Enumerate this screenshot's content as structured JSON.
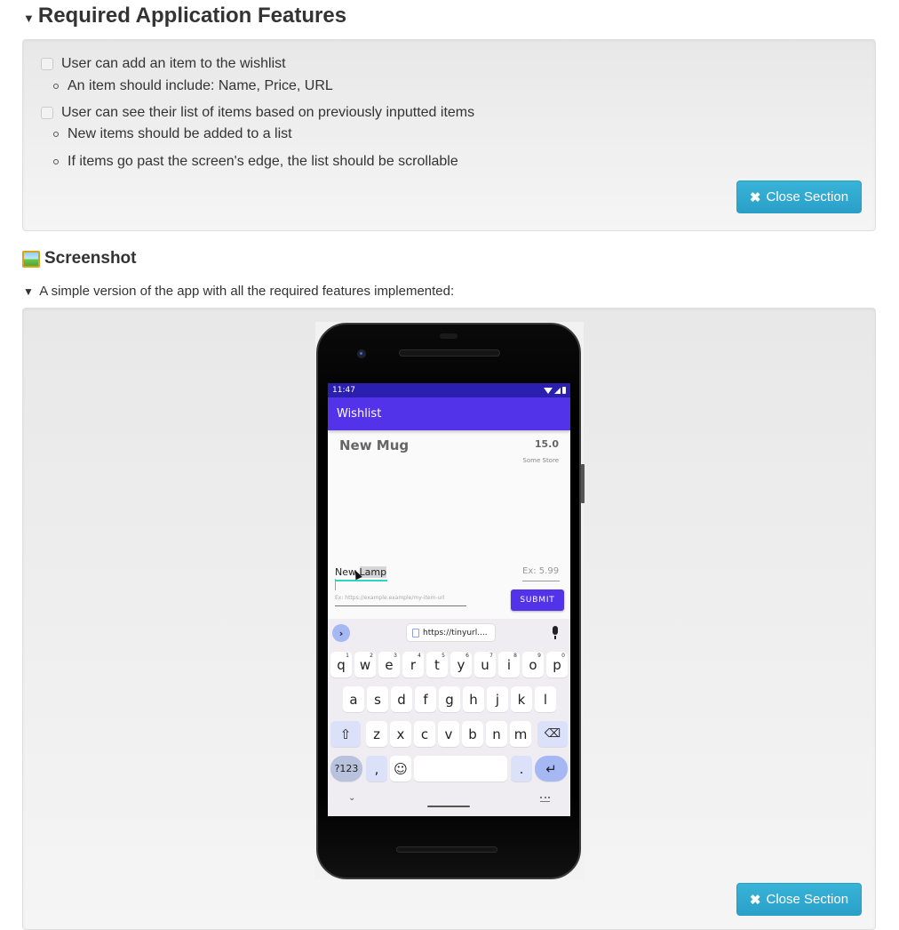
{
  "section1": {
    "title": "Required Application Features",
    "tasks": [
      {
        "label": "User can add an item to the wishlist",
        "checked": false,
        "subitems": [
          "An item should include: Name, Price, URL"
        ]
      },
      {
        "label": "User can see their list of items based on previously inputted items",
        "checked": false,
        "subitems": [
          "New items should be added to a list",
          "If items go past the screen's edge, the list should be scrollable"
        ]
      }
    ],
    "close_label": "Close Section",
    "close_icon": "✖"
  },
  "section2": {
    "title": "Screenshot",
    "icon": "framed-picture-icon",
    "summary": "A simple version of the app with all the required features implemented:",
    "close_label": "Close Section",
    "close_icon": "✖"
  },
  "phone": {
    "status_time": "11:47",
    "app_title": "Wishlist",
    "items": [
      {
        "name": "New Mug",
        "price": "15.0",
        "store": "Some Store"
      }
    ],
    "name_input_value": "New Lamp",
    "name_input_value_prefix": "New",
    "name_input_value_selected": "Lamp",
    "price_placeholder": "Ex: 5.99",
    "url_placeholder": "Ex: https://example.example/my-item-url",
    "submit_label": "SUBMIT",
    "keyboard": {
      "clipboard_suggestion": "https://tinyurl....",
      "row1": [
        {
          "k": "q",
          "n": "1"
        },
        {
          "k": "w",
          "n": "2"
        },
        {
          "k": "e",
          "n": "3"
        },
        {
          "k": "r",
          "n": "4"
        },
        {
          "k": "t",
          "n": "5"
        },
        {
          "k": "y",
          "n": "6"
        },
        {
          "k": "u",
          "n": "7"
        },
        {
          "k": "i",
          "n": "8"
        },
        {
          "k": "o",
          "n": "9"
        },
        {
          "k": "p",
          "n": "0"
        }
      ],
      "row2": [
        "a",
        "s",
        "d",
        "f",
        "g",
        "h",
        "j",
        "k",
        "l"
      ],
      "row3": [
        "z",
        "x",
        "c",
        "v",
        "b",
        "n",
        "m"
      ],
      "sym_label": "?123",
      "comma": ",",
      "emoji": "☺",
      "period": ".",
      "enter": "↵",
      "shift": "⇧",
      "backspace": "⌫",
      "expand": "›",
      "hide": "⌄"
    }
  }
}
